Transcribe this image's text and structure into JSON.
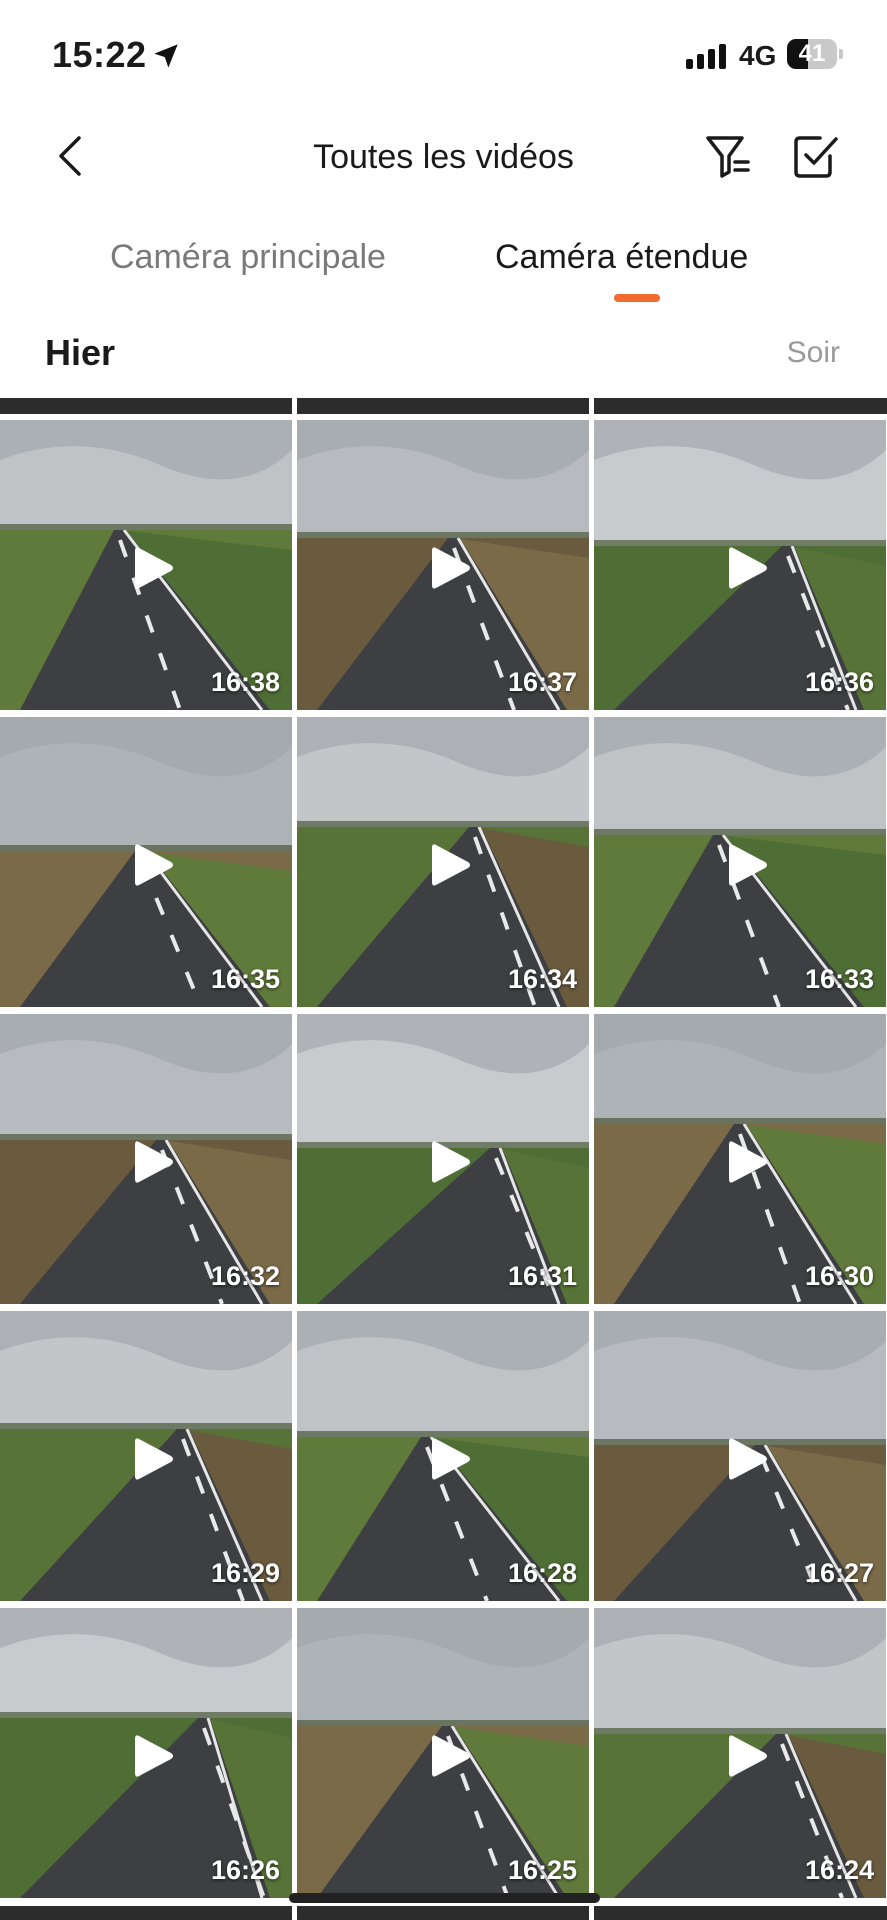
{
  "status_bar": {
    "time": "15:22",
    "network": "4G",
    "battery": "41",
    "battery_level": 0.41
  },
  "header": {
    "title": "Toutes les vidéos"
  },
  "tabs": [
    {
      "label": "Caméra principale",
      "active": false
    },
    {
      "label": "Caméra étendue",
      "active": true
    }
  ],
  "accent_color": "#f26a2e",
  "section": {
    "day": "Hier",
    "period": "Soir"
  },
  "videos": [
    {
      "time": "16:38"
    },
    {
      "time": "16:37"
    },
    {
      "time": "16:36"
    },
    {
      "time": "16:35"
    },
    {
      "time": "16:34"
    },
    {
      "time": "16:33"
    },
    {
      "time": "16:32"
    },
    {
      "time": "16:31"
    },
    {
      "time": "16:30"
    },
    {
      "time": "16:29"
    },
    {
      "time": "16:28"
    },
    {
      "time": "16:27"
    },
    {
      "time": "16:26"
    },
    {
      "time": "16:25"
    },
    {
      "time": "16:24"
    }
  ],
  "icons": {
    "back": "chevron-left-icon",
    "filter": "filter-icon",
    "select": "checkbox-icon",
    "play": "play-icon",
    "location": "location-arrow-icon"
  }
}
